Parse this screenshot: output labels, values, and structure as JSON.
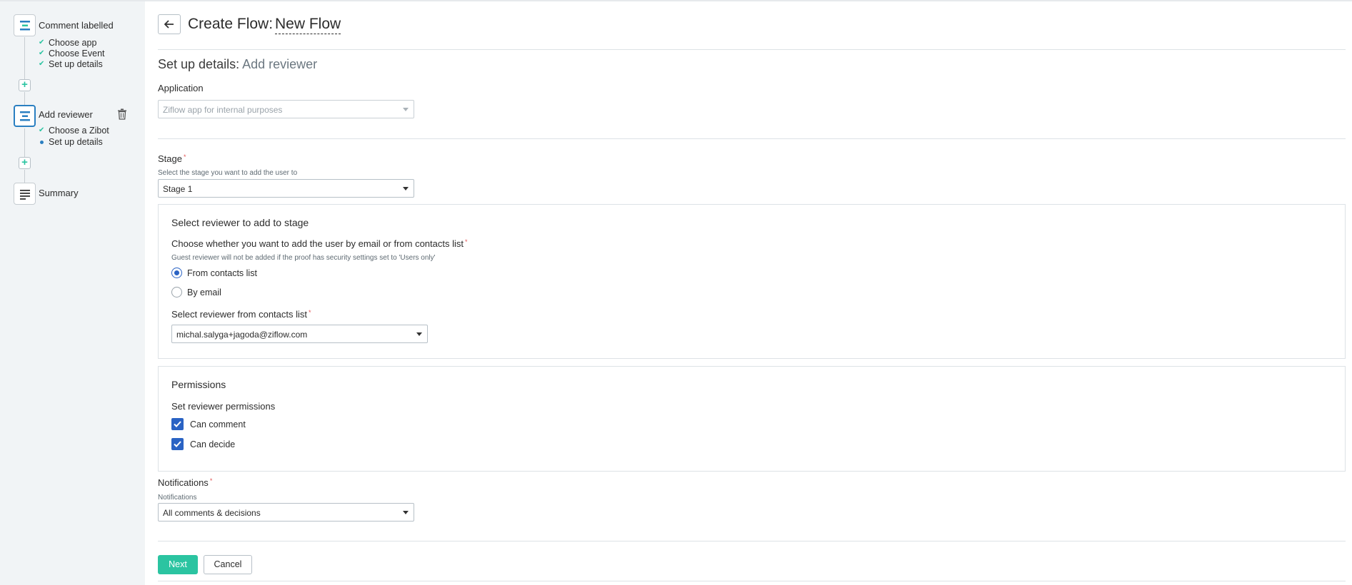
{
  "sidebar": {
    "steps": [
      {
        "title": "Comment labelled",
        "substeps": [
          {
            "label": "Choose app",
            "status": "done"
          },
          {
            "label": "Choose Event",
            "status": "done"
          },
          {
            "label": "Set up details",
            "status": "done"
          }
        ]
      },
      {
        "title": "Add reviewer",
        "substeps": [
          {
            "label": "Choose a Zibot",
            "status": "done"
          },
          {
            "label": "Set up details",
            "status": "current"
          }
        ]
      },
      {
        "title": "Summary",
        "substeps": []
      }
    ],
    "add_step_icon": "plus-icon",
    "delete_icon": "trash-icon"
  },
  "header": {
    "title": "Create Flow:",
    "flow_name": "New Flow",
    "back_icon": "arrow-left-icon"
  },
  "section": {
    "heading": "Set up details:",
    "subheading": "Add reviewer"
  },
  "application": {
    "label": "Application",
    "value": "Ziflow app for internal purposes"
  },
  "stage": {
    "label": "Stage",
    "help": "Select the stage you want to add the user to",
    "value": "Stage 1"
  },
  "reviewer_panel": {
    "title": "Select reviewer to add to stage",
    "method_label": "Choose whether you want to add the user by email or from contacts list",
    "method_help": "Guest reviewer will not be added if the proof has security settings set to 'Users only'",
    "options": [
      {
        "label": "From contacts list",
        "checked": true
      },
      {
        "label": "By email",
        "checked": false
      }
    ],
    "contact_label": "Select reviewer from contacts list",
    "contact_value": "michal.salyga+jagoda@ziflow.com"
  },
  "permissions_panel": {
    "title": "Permissions",
    "label": "Set reviewer permissions",
    "options": [
      {
        "label": "Can comment",
        "checked": true
      },
      {
        "label": "Can decide",
        "checked": true
      }
    ]
  },
  "notifications": {
    "label": "Notifications",
    "help": "Notifications",
    "value": "All comments & decisions"
  },
  "actions": {
    "next_label": "Next",
    "cancel_label": "Cancel"
  },
  "colors": {
    "accent_green": "#2bc4a1",
    "accent_blue": "#2a63c4",
    "step_active_blue": "#2a7fc1",
    "sidebar_bg": "#f1f4f6"
  }
}
